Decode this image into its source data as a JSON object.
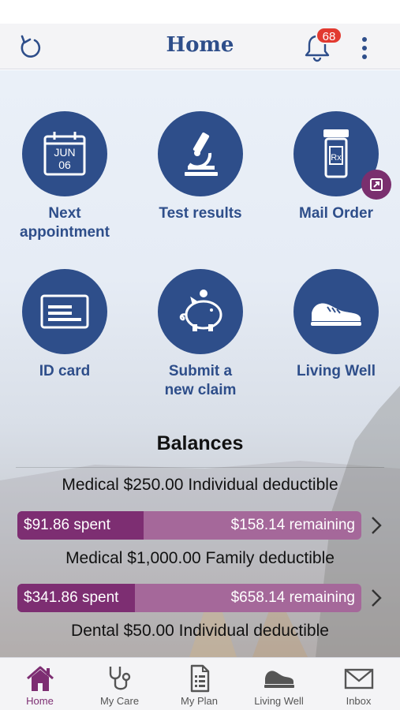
{
  "header": {
    "title": "Home",
    "notification_count": "68"
  },
  "tiles": [
    {
      "label": "Next appointment",
      "icon": "calendar-icon",
      "calendar_month": "JUN",
      "calendar_day": "06"
    },
    {
      "label": "Test results",
      "icon": "microscope-icon"
    },
    {
      "label": "Mail Order",
      "icon": "pill-bottle-icon",
      "badge_icon": "external-link-icon"
    },
    {
      "label": "ID card",
      "icon": "id-card-icon"
    },
    {
      "label": "Submit a new claim",
      "icon": "piggy-bank-icon"
    },
    {
      "label": "Living Well",
      "icon": "sneaker-icon"
    }
  ],
  "balances": {
    "title": "Balances",
    "items": [
      {
        "description": "Medical $250.00 Individual deductible",
        "spent": "$91.86 spent",
        "remaining": "$158.14 remaining",
        "spent_fraction": 0.3674
      },
      {
        "description": "Medical $1,000.00 Family deductible",
        "spent": "$341.86 spent",
        "remaining": "$658.14 remaining",
        "spent_fraction": 0.3419
      },
      {
        "description": "Dental $50.00 Individual deductible"
      }
    ]
  },
  "tabs": [
    {
      "label": "Home",
      "icon": "house-icon",
      "active": true
    },
    {
      "label": "My Care",
      "icon": "stethoscope-icon"
    },
    {
      "label": "My Plan",
      "icon": "document-icon"
    },
    {
      "label": "Living Well",
      "icon": "sneaker-icon"
    },
    {
      "label": "Inbox",
      "icon": "envelope-icon"
    }
  ],
  "colors": {
    "primary_blue": "#2e4e8a",
    "purple_dark": "#7d2e72",
    "purple_light": "#a5689a",
    "badge_red": "#e23a30"
  }
}
